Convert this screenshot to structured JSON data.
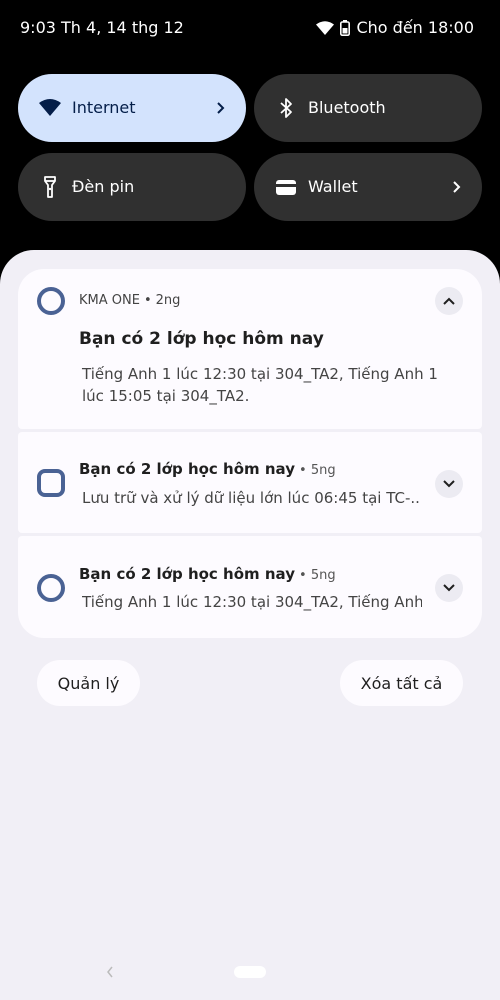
{
  "status": {
    "time": "9:03 Th 4, 14 thg 12",
    "battery_text": "Cho đến 18:00",
    "icons": [
      "wifi-icon",
      "battery-icon"
    ]
  },
  "quick_settings": [
    {
      "label": "Internet",
      "icon": "wifi-icon",
      "active": true,
      "has_chevron": true
    },
    {
      "label": "Bluetooth",
      "icon": "bluetooth-icon",
      "active": false,
      "has_chevron": false
    },
    {
      "label": "Đèn pin",
      "icon": "flashlight-icon",
      "active": false,
      "has_chevron": false
    },
    {
      "label": "Wallet",
      "icon": "wallet-icon",
      "active": false,
      "has_chevron": true
    }
  ],
  "notifications": {
    "expanded": {
      "app_name": "KMA ONE",
      "time": "2ng",
      "title": "Bạn có 2 lớp học hôm nay",
      "body": "Tiếng Anh 1 lúc 12:30 tại 304_TA2, Tiếng Anh 1 lúc 15:05 tại 304_TA2."
    },
    "items": [
      {
        "title": "Bạn có 2 lớp học hôm nay",
        "time": "5ng",
        "body": "Lưu trữ và xử lý dữ liệu lớn lúc 06:45 tại TC-..",
        "icon": "square-ring-icon"
      },
      {
        "title": "Bạn có 2 lớp học hôm nay",
        "time": "5ng",
        "body": "Tiếng Anh 1 lúc 12:30 tại 304_TA2, Tiếng Anh..",
        "icon": "circle-ring-icon"
      }
    ]
  },
  "actions": {
    "manage": "Quản lý",
    "clear_all": "Xóa tất cả"
  },
  "colors": {
    "active_tile": "#d3e3fd",
    "tile": "#303030",
    "shade": "#f1eff6",
    "app_icon": "#4a6294"
  }
}
